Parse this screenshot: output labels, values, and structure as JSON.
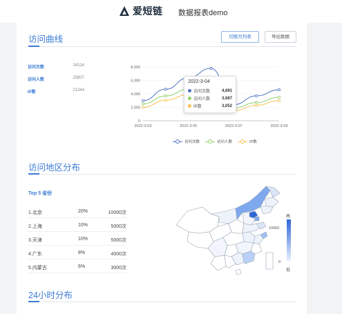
{
  "header": {
    "brand_name": "爱短链",
    "page_name": "数据报表demo",
    "brand_color": "#1f2d3d"
  },
  "visit_curve": {
    "section_title": "访问曲线",
    "switch_button": "切换为列表",
    "export_button": "导出数据",
    "stats": [
      {
        "label": "访问次数",
        "value": "34114"
      },
      {
        "label": "访问人数",
        "value": "25807"
      },
      {
        "label": "IP数",
        "value": "21344"
      }
    ],
    "tooltip": {
      "date": "2022-3-04",
      "rows": [
        {
          "name": "访问次数",
          "value": "4,691",
          "color": "#4f72c4"
        },
        {
          "name": "访问人数",
          "value": "3,687",
          "color": "#8fcf6b"
        },
        {
          "name": "IP数",
          "value": "3,052",
          "color": "#f5c04f"
        }
      ]
    }
  },
  "chart_data": {
    "type": "line",
    "x": [
      "2022-3-03",
      "2022-3-04",
      "2022-3-05",
      "2022-3-06",
      "2022-3-07",
      "2022-3-08",
      "2022-3-09"
    ],
    "x_tick_labels": [
      "2022-3-03",
      "2022-3-05",
      "2022-3-07",
      "2022-3-09"
    ],
    "y_tick_labels": [
      "0",
      "2,000",
      "4,000",
      "6,000",
      "8,000"
    ],
    "ylim": [
      0,
      8000
    ],
    "grid": true,
    "legend_position": "bottom",
    "series": [
      {
        "name": "访问次数",
        "color": "#4f72c4",
        "values": [
          3000,
          4691,
          6400,
          7800,
          2400,
          3700,
          4600
        ]
      },
      {
        "name": "访问人数",
        "color": "#8fcf6b",
        "values": [
          2500,
          3687,
          4700,
          5300,
          1900,
          2700,
          3500
        ]
      },
      {
        "name": "IP数",
        "color": "#f5c04f",
        "values": [
          2000,
          3052,
          3900,
          4300,
          1500,
          2300,
          3000
        ]
      }
    ]
  },
  "region": {
    "section_title": "访问地区分布",
    "top5_title": "Top 5 省份",
    "rows": [
      {
        "name": "1.北京",
        "pct": "20%",
        "count": "10000次"
      },
      {
        "name": "2.上海",
        "pct": "10%",
        "count": "5000次"
      },
      {
        "name": "3.天津",
        "pct": "10%",
        "count": "5000次"
      },
      {
        "name": "4.广东",
        "pct": "8%",
        "count": "4000次"
      },
      {
        "name": "5.内蒙古",
        "pct": "6%",
        "count": "3000次"
      }
    ],
    "visual_map": {
      "high_label": "高",
      "low_label": "低",
      "max_value": "10000",
      "min_value": "0",
      "high_color": "#2f66d8",
      "low_color": "#e8f0fd"
    }
  },
  "hourly": {
    "section_title": "24小时分布"
  }
}
